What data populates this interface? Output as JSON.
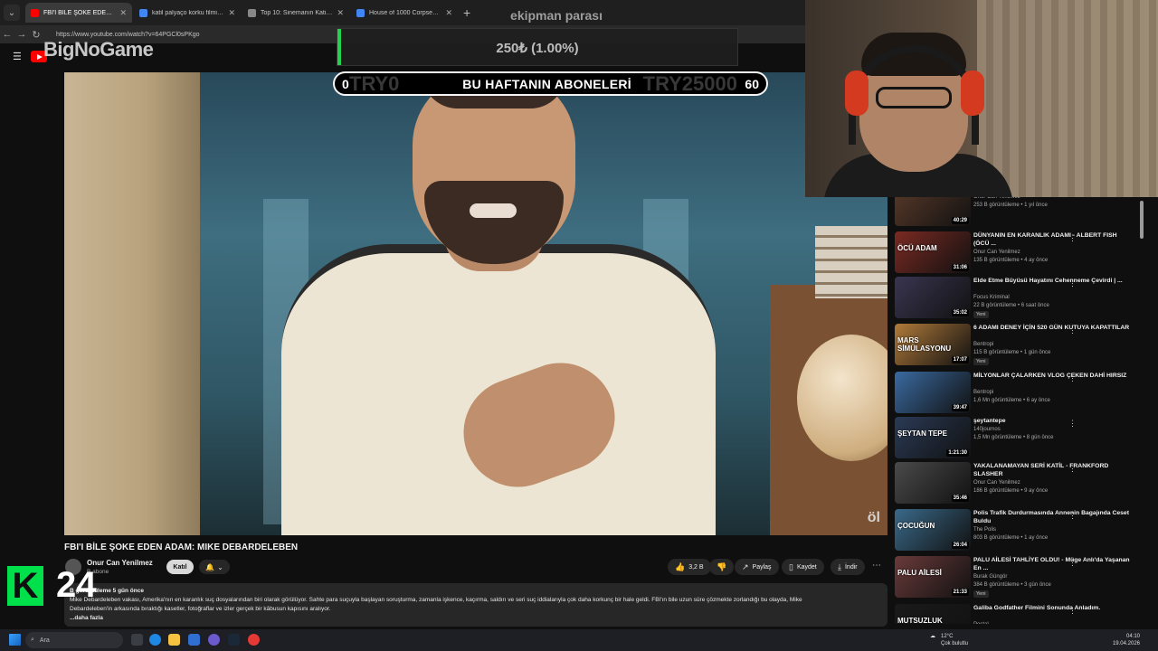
{
  "browser": {
    "tabs": [
      {
        "title": "FBI'I BİLE ŞOKE EDEN ADAM: MIK",
        "active": true,
        "favicon_color": "#ff0000"
      },
      {
        "title": "katil palyaço korku filmi - Google",
        "active": false,
        "favicon_color": "#4285f4"
      },
      {
        "title": "Top 10: Sinemanın Katil Palyaçoları",
        "active": false,
        "favicon_color": "#888888"
      },
      {
        "title": "House of 1000 Corpses - Google",
        "active": false,
        "favicon_color": "#4285f4"
      }
    ],
    "url": "https://www.youtube.com/watch?v=64PGCl0sPKgo"
  },
  "overlays": {
    "brand": "BigNoGame",
    "donation_title": "ekipman parası",
    "donation_amount": "250₺ (1.00%)",
    "donation_progress_fraction": 0.01,
    "subs_min": "0",
    "subs_title": "BU HAFTANIN ABONELERİ",
    "subs_max": "60",
    "subs_ghost_left": "TRY0",
    "subs_ghost_right": "TRY25000",
    "k24_letter": "K",
    "k24_number": "24",
    "video_watermark": "öl"
  },
  "video": {
    "title": "FBI'I BİLE ŞOKE EDEN ADAM: MIKE DEBARDELEBEN",
    "channel": "Onur Can Yenilmez",
    "subscribers": "B abone",
    "join_label": "Katıl",
    "actions": {
      "likes": "3,2 B",
      "share": "Paylaş",
      "save": "Kaydet",
      "download": "İndir"
    },
    "description": {
      "meta": "B görüntüleme  5 gün önce",
      "line1": "Mike Debardeleben vakası, Amerika'nın en karanlık suç dosyalarından biri olarak görülüyor. Sahte para suçuyla başlayan soruşturma, zamanla işkence, kaçırma, saldırı ve seri suç iddialarıyla çok daha korkunç bir hale geldi. FBI'ın bile uzun süre çözmekte zorlandığı bu olayda, Mike",
      "line2": "Debardeleben'in arkasında bıraktığı kasetler, fotoğraflar ve izler gerçek bir kâbusun kapısını aralıyor.",
      "more": "...daha fazla"
    }
  },
  "recommendations": [
    {
      "title": "",
      "channel": "Onur Can Yenilmez",
      "meta": "253 B görüntüleme • 1 yıl önce",
      "duration": "40:29",
      "thumb_label": "",
      "thumb_color": "#5a3a2a",
      "new": false
    },
    {
      "title": "DÜNYANIN EN KARANLIK ADAMI - ALBERT FISH (ÖCÜ ...",
      "channel": "Onur Can Yenilmez",
      "meta": "135 B görüntüleme • 4 ay önce",
      "duration": "31:06",
      "thumb_label": "ÖCÜ ADAM",
      "thumb_color": "#7a2a22",
      "new": false
    },
    {
      "title": "Elde Etme Büyüsü Hayatını Cehenneme Çevirdi | ...",
      "channel": "Focus Kriminal",
      "meta": "22 B görüntüleme • 6 saat önce",
      "duration": "35:02",
      "thumb_label": "",
      "thumb_color": "#3a3550",
      "new": true
    },
    {
      "title": "6 ADAMI DENEY İÇİN 520 GÜN KUTUYA KAPATTILAR",
      "channel": "Bentropi",
      "meta": "115 B görüntüleme • 1 gün önce",
      "duration": "17:07",
      "thumb_label": "MARS SİMÜLASYONU",
      "thumb_color": "#b07a3a",
      "new": true
    },
    {
      "title": "MİLYONLAR ÇALARKEN VLOG ÇEKEN DAHİ HIRSIZ",
      "channel": "Bentropi",
      "meta": "1,6 Mn görüntüleme • 6 ay önce",
      "duration": "39:47",
      "thumb_label": "",
      "thumb_color": "#3a6aa0",
      "new": false
    },
    {
      "title": "şeytantepe",
      "channel": "140journos",
      "meta": "1,5 Mn görüntüleme • 8 gün önce",
      "duration": "1:21:30",
      "thumb_label": "ŞEYTAN TEPE",
      "thumb_color": "#2a3a55",
      "new": false
    },
    {
      "title": "YAKALANAMAYAN SERİ KATİL - FRANKFORD SLASHER",
      "channel": "Onur Can Yenilmez",
      "meta": "186 B görüntüleme • 9 ay önce",
      "duration": "35:46",
      "thumb_label": "",
      "thumb_color": "#4a4a4a",
      "new": false
    },
    {
      "title": "Polis Trafik Durdurmasında Annenin Bagajında Ceset Buldu",
      "channel": "The Polis",
      "meta": "803 B görüntüleme • 1 ay önce",
      "duration": "26:04",
      "thumb_label": "ÇOCUĞUN",
      "thumb_color": "#3a6a8a",
      "new": false
    },
    {
      "title": "PALU AİLESİ TAHLİYE OLDU! - Müge Anlı'da Yaşanan En ...",
      "channel": "Burak Güngör",
      "meta": "384 B görüntüleme • 3 gün önce",
      "duration": "21:33",
      "thumb_label": "PALU AİLESİ",
      "thumb_color": "#6a3a3a",
      "new": true
    },
    {
      "title": "Galiba Godfather Filmini Sonunda Anladım.",
      "channel": "Postal",
      "meta": "",
      "duration": "",
      "thumb_label": "MUTSUZLUK",
      "thumb_color": "#1a1a1a",
      "new": false
    }
  ],
  "taskbar": {
    "search_placeholder": "Ara",
    "weather_temp": "12°C",
    "weather_text": "Çok bulutlu",
    "time": "04:10",
    "date": "19.04.2026"
  }
}
